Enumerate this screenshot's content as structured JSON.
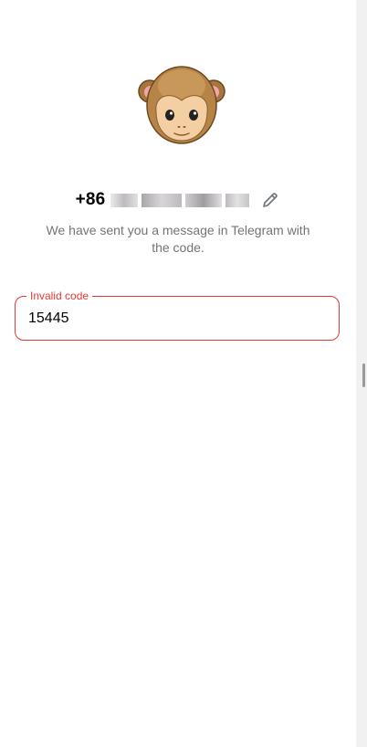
{
  "login": {
    "phone_prefix": "+86",
    "message": "We have sent you a message in Telegram with the code.",
    "code_field": {
      "label": "Invalid code",
      "value": "15445"
    }
  },
  "icons": {
    "avatar": "monkey-face",
    "edit": "pencil-icon"
  },
  "colors": {
    "error": "#e53935",
    "secondary_text": "#707579",
    "side_strip": "#f1f1f2"
  }
}
